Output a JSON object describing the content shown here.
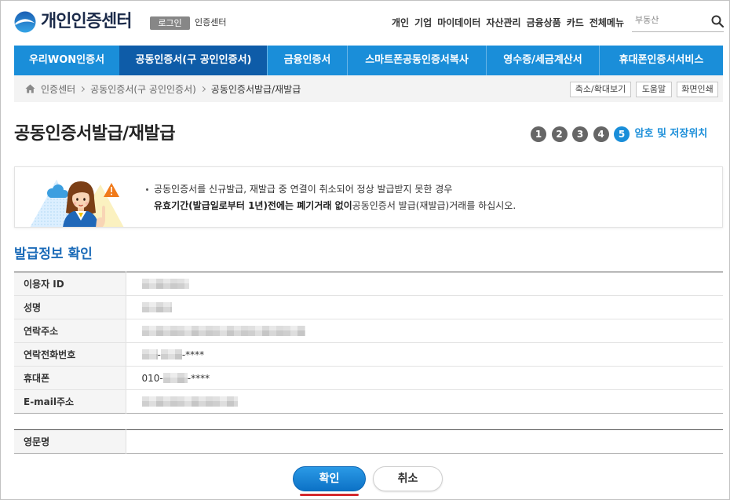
{
  "colors": {
    "brand_blue": "#1a8ed9",
    "nav_active": "#0e5ca8",
    "section_title": "#1b6bb8",
    "step_inactive": "#666666",
    "highlight_red": "#d42a2f"
  },
  "icons": {
    "logo": "woori-logo-icon",
    "search": "search-icon",
    "home": "home-icon",
    "breadcrumb_separator": "chevron-right-icon",
    "notice_illustration": "guide-woman-illustration",
    "warning": "warning-icon"
  },
  "header": {
    "logo_text": "개인인증센터",
    "login_badge": "로그인",
    "site_label": "인증센터",
    "top_links": [
      "개인",
      "기업",
      "마이데이터",
      "자산관리",
      "금융상품",
      "카드",
      "전체메뉴"
    ],
    "search": {
      "placeholder": "부동산",
      "value": ""
    }
  },
  "gnb": {
    "active_index": 1,
    "tabs": [
      {
        "label": "우리WON인증서"
      },
      {
        "label": "공동인증서(구 공인인증서)"
      },
      {
        "label": "금융인증서"
      },
      {
        "label": "스마트폰공동인증서복사"
      },
      {
        "label": "영수증/세금계산서"
      },
      {
        "label": "휴대폰인증서서비스"
      }
    ]
  },
  "breadcrumb": {
    "items": [
      "인증센터",
      "공동인증서(구 공인인증서)",
      "공동인증서발급/재발급"
    ],
    "tools": [
      "축소/확대보기",
      "도움말",
      "화면인쇄"
    ]
  },
  "page": {
    "title": "공동인증서발급/재발급",
    "steps": {
      "labels": [
        "1",
        "2",
        "3",
        "4",
        "5"
      ],
      "current": 5,
      "current_label": "암호 및 저장위치"
    }
  },
  "notice": {
    "line1": "공동인증서를 신규발급, 재발급 중 연결이 취소되어 정상 발급받지 못한 경우",
    "line2_bold": "유효기간(발급일로부터 1년)전에는 폐기거래 없이",
    "line2_rest": "공동인증서 발급(재발급)거래를 하십시오."
  },
  "issue_info": {
    "title": "발급정보 확인",
    "rows": [
      {
        "label": "이용자 ID"
      },
      {
        "label": "성명"
      },
      {
        "label": "연락주소"
      },
      {
        "label": "연락전화번호",
        "separator": "-",
        "suffix": "-****"
      },
      {
        "label": "휴대폰",
        "prefix": "010-",
        "suffix": "-****"
      },
      {
        "label": "E-mail주소"
      }
    ],
    "extra_rows": [
      {
        "label": "영문명",
        "value": ""
      }
    ]
  },
  "buttons": {
    "confirm": "확인",
    "cancel": "취소"
  }
}
